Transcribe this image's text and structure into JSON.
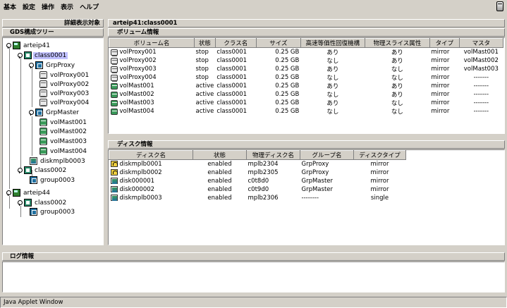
{
  "menu": [
    "基本",
    "設定",
    "操作",
    "表示",
    "ヘルプ"
  ],
  "detail_button": "詳細表示対象",
  "tree_title": "GDS構成ツリー",
  "tree": {
    "arteip41": "arteip41",
    "class0001": "class0001",
    "grpproxy": "GrpProxy",
    "volproxy001": "volProxy001",
    "volproxy002": "volProxy002",
    "volproxy003": "volProxy003",
    "volproxy004": "volProxy004",
    "grpmaster": "GrpMaster",
    "volmast001": "volMast001",
    "volmast002": "volMast002",
    "volmast003": "volMast003",
    "volmast004": "volMast004",
    "diskmplb0003": "diskmplb0003",
    "class0002": "class0002",
    "group0003": "group0003",
    "arteip44": "arteip44",
    "class0002b": "class0002",
    "group0003b": "group0003"
  },
  "right_title": "arteip41:class0001",
  "volume_section": "ボリューム情報",
  "volume_headers": [
    "ボリューム名",
    "状態",
    "クラス名",
    "サイズ",
    "高速等価性回復機構",
    "物理スライス属性",
    "タイプ",
    "マスタ"
  ],
  "volumes": [
    {
      "name": "volProxy001",
      "state": "stop",
      "class": "class0001",
      "size": "0.25 GB",
      "fast": "あり",
      "slice": "あり",
      "type": "mirror",
      "master": "volMast001",
      "icon": "vol"
    },
    {
      "name": "volProxy002",
      "state": "stop",
      "class": "class0001",
      "size": "0.25 GB",
      "fast": "なし",
      "slice": "あり",
      "type": "mirror",
      "master": "volMast002",
      "icon": "vol"
    },
    {
      "name": "volProxy003",
      "state": "stop",
      "class": "class0001",
      "size": "0.25 GB",
      "fast": "あり",
      "slice": "なし",
      "type": "mirror",
      "master": "volMast003",
      "icon": "vol"
    },
    {
      "name": "volProxy004",
      "state": "stop",
      "class": "class0001",
      "size": "0.25 GB",
      "fast": "なし",
      "slice": "なし",
      "type": "mirror",
      "master": "-------",
      "icon": "vol"
    },
    {
      "name": "volMast001",
      "state": "active",
      "class": "class0001",
      "size": "0.25 GB",
      "fast": "あり",
      "slice": "あり",
      "type": "mirror",
      "master": "-------",
      "icon": "volm"
    },
    {
      "name": "volMast002",
      "state": "active",
      "class": "class0001",
      "size": "0.25 GB",
      "fast": "なし",
      "slice": "あり",
      "type": "mirror",
      "master": "-------",
      "icon": "volm"
    },
    {
      "name": "volMast003",
      "state": "active",
      "class": "class0001",
      "size": "0.25 GB",
      "fast": "あり",
      "slice": "なし",
      "type": "mirror",
      "master": "-------",
      "icon": "volm"
    },
    {
      "name": "volMast004",
      "state": "active",
      "class": "class0001",
      "size": "0.25 GB",
      "fast": "なし",
      "slice": "なし",
      "type": "mirror",
      "master": "-------",
      "icon": "volm"
    }
  ],
  "disk_section": "ディスク情報",
  "disk_headers": [
    "ディスク名",
    "状態",
    "物理ディスク名",
    "グループ名",
    "ディスクタイプ"
  ],
  "disks": [
    {
      "name": "diskmplb0001",
      "state": "enabled",
      "phys": "mplb2304",
      "group": "GrpProxy",
      "type": "mirror",
      "icon": "disklock"
    },
    {
      "name": "diskmplb0002",
      "state": "enabled",
      "phys": "mplb2305",
      "group": "GrpProxy",
      "type": "mirror",
      "icon": "disklock"
    },
    {
      "name": "disk000001",
      "state": "enabled",
      "phys": "c0t8d0",
      "group": "GrpMaster",
      "type": "mirror",
      "icon": "disk"
    },
    {
      "name": "disk000002",
      "state": "enabled",
      "phys": "c0t9d0",
      "group": "GrpMaster",
      "type": "mirror",
      "icon": "disk"
    },
    {
      "name": "diskmplb0003",
      "state": "enabled",
      "phys": "mplb2306",
      "group": "--------",
      "type": "single",
      "icon": "disk"
    }
  ],
  "log_section": "ログ情報",
  "status": "Java Applet Window"
}
